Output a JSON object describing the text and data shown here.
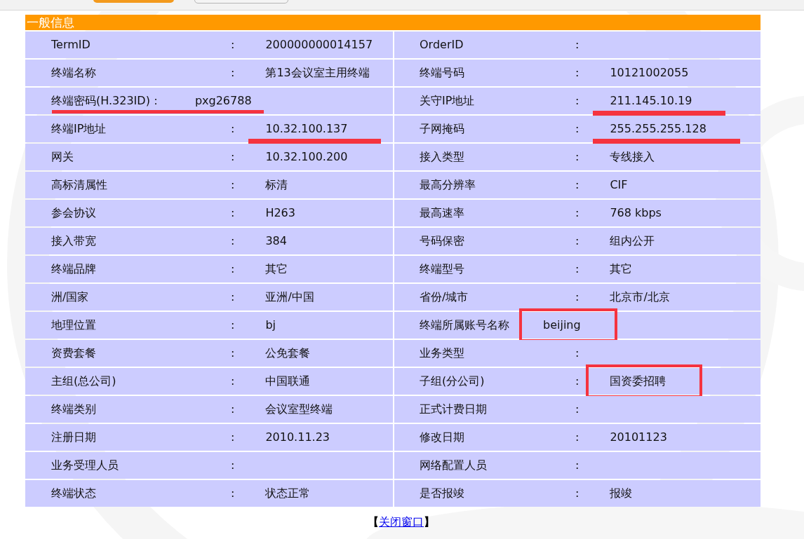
{
  "section": {
    "title": "一般信息"
  },
  "rows": [
    [
      {
        "label": "TermID",
        "colon": ":",
        "value": "200000000014157"
      },
      {
        "label": "OrderID",
        "colon": ":"
      }
    ],
    [
      {
        "label": "终端名称",
        "colon": ":",
        "value": "第13会议室主用终端"
      },
      {
        "label": "终端号码",
        "colon": ":",
        "value": "10121002055"
      }
    ],
    [
      {
        "label": "终端密码(H.323ID)：",
        "value": "pxg26788",
        "underlined": true
      },
      {
        "label": "关守IP地址",
        "colon": ":",
        "value": "211.145.10.19",
        "underlined": true
      }
    ],
    [
      {
        "label": "终端IP地址",
        "colon": ":",
        "value": "10.32.100.137",
        "underlined": true
      },
      {
        "label": "子网掩码",
        "colon": ":",
        "value": "255.255.255.128",
        "underlined": true
      }
    ],
    [
      {
        "label": "网关",
        "colon": ":",
        "value": "10.32.100.200"
      },
      {
        "label": "接入类型",
        "colon": ":",
        "value": "专线接入"
      }
    ],
    [
      {
        "label": "高标清属性",
        "colon": ":",
        "value": "标清"
      },
      {
        "label": "最高分辨率",
        "colon": ":",
        "value": "CIF"
      }
    ],
    [
      {
        "label": "参会协议",
        "colon": ":",
        "value": "H263"
      },
      {
        "label": "最高速率",
        "colon": ":",
        "value": "768 kbps"
      }
    ],
    [
      {
        "label": "接入带宽",
        "colon": ":",
        "value": "384"
      },
      {
        "label": "号码保密",
        "colon": ":",
        "value": "组内公开"
      }
    ],
    [
      {
        "label": "终端品牌",
        "colon": ":",
        "value": "其它"
      },
      {
        "label": "终端型号",
        "colon": ":",
        "value": "其它"
      }
    ],
    [
      {
        "label": "洲/国家",
        "colon": ":",
        "value": "亚洲/中国"
      },
      {
        "label": "省份/城市",
        "colon": ":",
        "value": "北京市/北京"
      }
    ],
    [
      {
        "label": "地理位置",
        "colon": ":",
        "value": "bj"
      },
      {
        "label": "终端所属账号名称",
        "value": "beijing",
        "boxed": true
      }
    ],
    [
      {
        "label": "资费套餐",
        "colon": ":",
        "value": "公免套餐"
      },
      {
        "label": "业务类型",
        "colon": ":"
      }
    ],
    [
      {
        "label": "主组(总公司)",
        "colon": ":",
        "value": "中国联通"
      },
      {
        "label": "子组(分公司)",
        "colon": ":",
        "value": "国资委招聘",
        "boxed": true
      }
    ],
    [
      {
        "label": "终端类别",
        "colon": ":",
        "value": "会议室型终端"
      },
      {
        "label": "正式计费日期",
        "colon": ":"
      }
    ],
    [
      {
        "label": "注册日期",
        "colon": ":",
        "value": "2010.11.23"
      },
      {
        "label": "修改日期",
        "colon": ":",
        "value": "20101123"
      }
    ],
    [
      {
        "label": "业务受理人员",
        "colon": ":"
      },
      {
        "label": "网络配置人员",
        "colon": ":"
      }
    ],
    [
      {
        "label": "终端状态",
        "colon": ":",
        "value": "状态正常"
      },
      {
        "label": "是否报竣",
        "colon": ":",
        "value": "报竣"
      }
    ]
  ],
  "footer": {
    "open": "【",
    "link": "关闭窗口",
    "close": "】"
  }
}
